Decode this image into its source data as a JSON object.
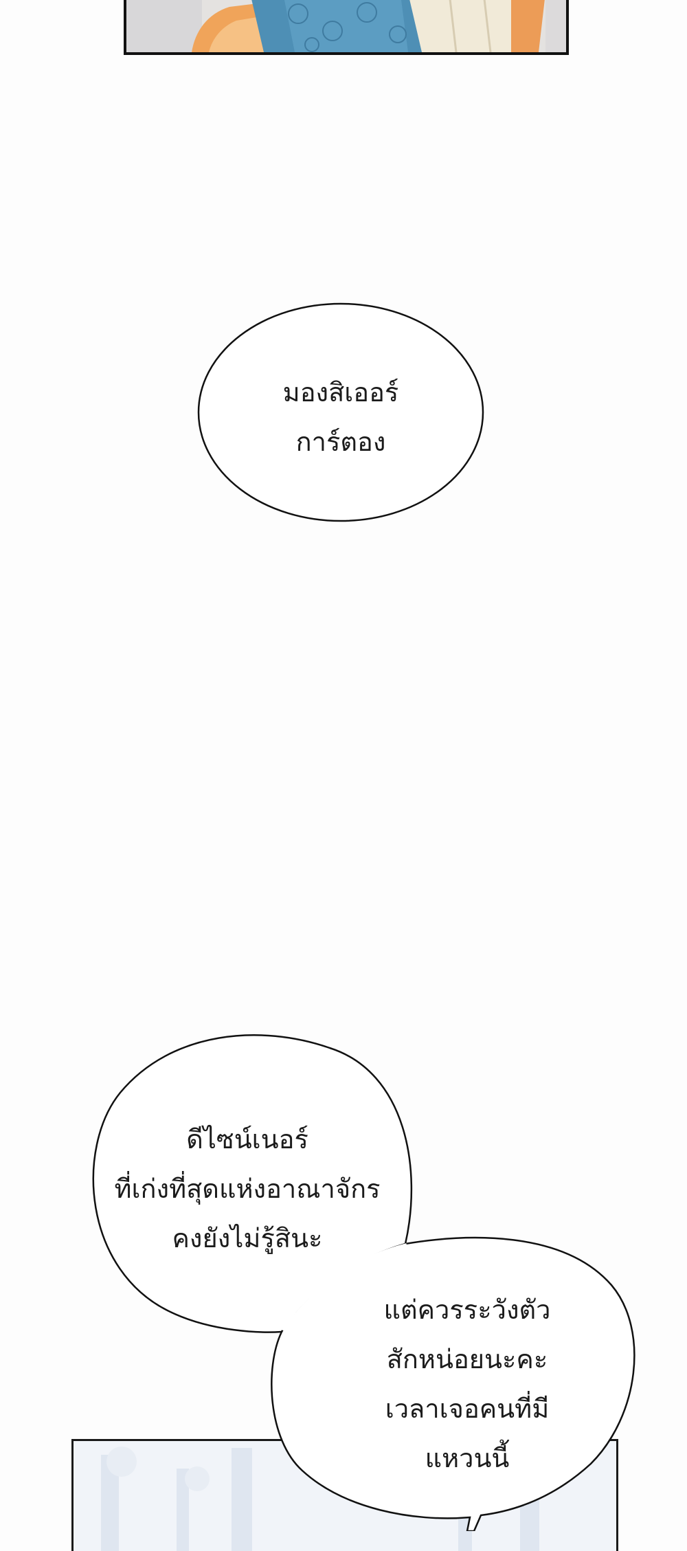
{
  "bubbles": {
    "first": {
      "lines": [
        "มองสิเออร์",
        "การ์ตอง"
      ]
    },
    "second": {
      "lines": [
        "ดีไซน์เนอร์",
        "ที่เก่งที่สุดแห่งอาณาจักร",
        "คงยังไม่รู้สินะ"
      ]
    },
    "third": {
      "lines": [
        "แต่ควรระวังตัว",
        "สักหน่อยนะคะ",
        "เวลาเจอคนที่มี",
        "แหวนนี้"
      ]
    }
  },
  "colors": {
    "page_background": "#fdfdfd",
    "outline": "#111111",
    "panel_top_sky": "#e4e2e0",
    "hair_orange": "#f0a45a",
    "cloak_blue": "#4e8fb5",
    "panel_bottom_sky": "#f1f4f9"
  }
}
